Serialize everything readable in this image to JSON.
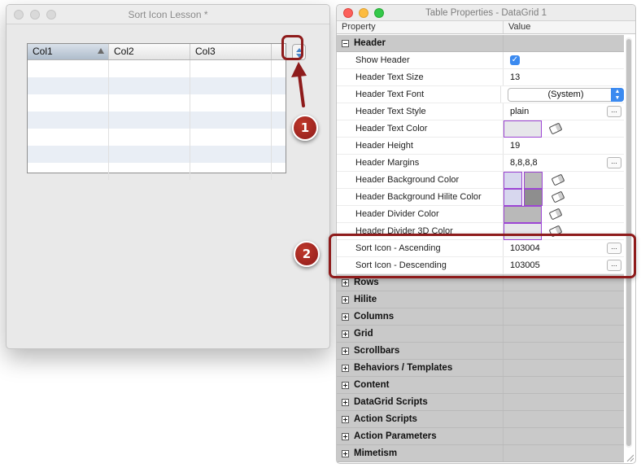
{
  "left_window": {
    "title": "Sort Icon Lesson *",
    "grid": {
      "columns": [
        "Col1",
        "Col2",
        "Col3"
      ],
      "sorted_column": "Col1",
      "row_count": 7
    }
  },
  "right_window": {
    "title": "Table Properties - DataGrid 1",
    "columns": {
      "property": "Property",
      "value": "Value"
    },
    "header_group": {
      "label": "Header",
      "items": [
        {
          "label": "Show Header",
          "kind": "checkbox",
          "checked": true
        },
        {
          "label": "Header Text Size",
          "kind": "text",
          "value": "13"
        },
        {
          "label": "Header Text Font",
          "kind": "select",
          "value": "(System)"
        },
        {
          "label": "Header Text Style",
          "kind": "text-dots",
          "value": "plain"
        },
        {
          "label": "Header Text Color",
          "kind": "color",
          "swatches": [
            "light"
          ]
        },
        {
          "label": "Header Height",
          "kind": "text",
          "value": "19"
        },
        {
          "label": "Header Margins",
          "kind": "text-dots",
          "value": "8,8,8,8"
        },
        {
          "label": "Header Background Color",
          "kind": "color",
          "swatches": [
            "lite",
            "gray"
          ]
        },
        {
          "label": "Header Background Hilite Color",
          "kind": "color",
          "swatches": [
            "lite",
            "dgray"
          ]
        },
        {
          "label": "Header Divider Color",
          "kind": "color",
          "swatches": [
            "gray"
          ]
        },
        {
          "label": "Header Divider 3D Color",
          "kind": "color",
          "swatches": [
            "light"
          ]
        },
        {
          "label": "Sort Icon - Ascending",
          "kind": "text-dots",
          "value": "103004"
        },
        {
          "label": "Sort Icon - Descending",
          "kind": "text-dots",
          "value": "103005"
        }
      ]
    },
    "collapsed_groups": [
      "Rows",
      "Hilite",
      "Columns",
      "Grid",
      "Scrollbars",
      "Behaviors / Templates",
      "Content",
      "DataGrid Scripts",
      "Action Scripts",
      "Action Parameters",
      "Mimetism"
    ]
  },
  "annotations": {
    "badge_1": "1",
    "badge_2": "2"
  },
  "colors": {
    "accent": "#3b8af0",
    "highlight": "#8e1b1b",
    "swatch_border": "#9d45d4",
    "group_bg": "#c9c9c9"
  }
}
